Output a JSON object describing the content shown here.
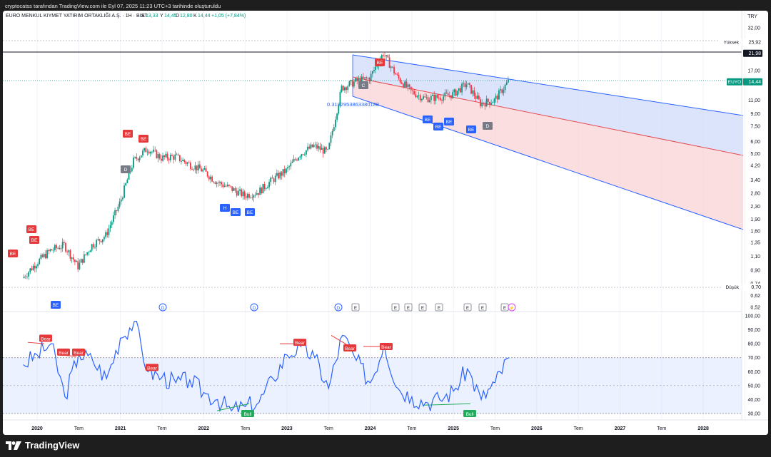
{
  "header": {
    "credit": "cryptocatss tarafından TradingView.com ile Eyl 07, 2025 11:23 UTC+3 tarihinde oluşturuldu",
    "currency": "TRY"
  },
  "legend": {
    "symbol": "EURO MENKUL KIYMET YATIRIM ORTAKLIĞI A.Ş. · 1H · BIST",
    "open_label": "A",
    "open": "13,33",
    "high_label": "Y",
    "high": "14,45",
    "low_label": "D",
    "low": "12,80",
    "close_label": "K",
    "close": "14,44",
    "change": "+1,05 (+7,84%)"
  },
  "price_axis": {
    "scale": "log",
    "ticks": [
      "32,00",
      "25,92",
      "21,98",
      "17,00",
      "14,44",
      "11,00",
      "9,00",
      "7,50",
      "6,00",
      "5,00",
      "4,20",
      "3,40",
      "2,80",
      "2,30",
      "1,90",
      "1,60",
      "1,35",
      "1,10",
      "0,90",
      "0,74",
      "0,70",
      "0,62",
      "0,52"
    ],
    "high_label": "Yüksek",
    "high_value": "25,92",
    "low_label": "Düşük",
    "low_value": "0,70",
    "line_value": "21,98",
    "ticker": "EUYO",
    "last_value": "14,44"
  },
  "rsi_axis": {
    "ticks": [
      "100,00",
      "90,00",
      "80,00",
      "70,00",
      "60,00",
      "50,00",
      "40,00",
      "30,00"
    ],
    "band": [
      30,
      70
    ]
  },
  "time_axis": {
    "ticks": [
      "2020",
      "Tem",
      "2021",
      "Tem",
      "2022",
      "Tem",
      "2023",
      "Tem",
      "2024",
      "Tem",
      "2025",
      "Tem",
      "2026",
      "Tem",
      "2027",
      "Tem",
      "2028"
    ]
  },
  "fib_label": "0.3182953863380188",
  "price_signals": [
    "BE",
    "BE",
    "BE",
    "BE",
    "BE",
    "BE",
    "D",
    "H",
    "BE",
    "BE",
    "C",
    "BE",
    "BE",
    "BE",
    "BE",
    "BE",
    "D"
  ],
  "event_markers": [
    "D",
    "D",
    "D",
    "E",
    "E",
    "E",
    "E",
    "E",
    "E",
    "E",
    "E",
    "⚡"
  ],
  "rsi_signals": [
    "Bear",
    "Bear",
    "Bear",
    "Bear",
    "Bear",
    "Bear",
    "Bear",
    "Bull",
    "Bull"
  ],
  "colors": {
    "up": "#089981",
    "down": "#f23645",
    "rsi": "#2962ff",
    "channel_upper": "#2962ff",
    "channel_mid": "#e5484d",
    "rsi_band": "#2962ff",
    "bull": "#22ab5a",
    "bear": "#e5383b"
  },
  "chart_data": [
    {
      "type": "candlestick",
      "title": "EURO MENKUL KIYMET YATIRIM ORTAKLIĞI A.Ş. · 1H · BIST",
      "ylabel": "TRY",
      "yscale": "log",
      "ylim": [
        0.5,
        32
      ],
      "x": [
        "2019-11",
        "2020-01",
        "2020-03",
        "2020-05",
        "2020-07",
        "2020-09",
        "2020-11",
        "2021-01",
        "2021-03",
        "2021-05",
        "2021-07",
        "2021-09",
        "2021-11",
        "2022-01",
        "2022-03",
        "2022-05",
        "2022-07",
        "2022-09",
        "2022-11",
        "2023-01",
        "2023-03",
        "2023-05",
        "2023-07",
        "2023-09",
        "2023-11",
        "2024-01",
        "2024-03",
        "2024-05",
        "2024-07",
        "2024-09",
        "2024-11",
        "2025-01",
        "2025-03",
        "2025-05",
        "2025-07",
        "2025-09"
      ],
      "close": [
        0.8,
        1.0,
        1.2,
        1.3,
        0.95,
        1.3,
        1.5,
        2.4,
        4.5,
        5.4,
        4.7,
        4.8,
        4.3,
        3.9,
        3.3,
        3.0,
        2.7,
        2.85,
        3.4,
        3.9,
        5.0,
        5.6,
        5.1,
        13.2,
        14.5,
        15.2,
        22.0,
        15.5,
        12.5,
        11.3,
        11.5,
        12.0,
        14.0,
        10.5,
        11.0,
        14.44
      ],
      "high_recorded": 25.92,
      "low_recorded": 0.7,
      "horizontal_line": 21.98
    },
    {
      "type": "line",
      "title": "RSI",
      "ylim": [
        25,
        100
      ],
      "x": [
        "2019-11",
        "2020-01",
        "2020-03",
        "2020-05",
        "2020-07",
        "2020-09",
        "2020-11",
        "2021-01",
        "2021-03",
        "2021-05",
        "2021-07",
        "2021-09",
        "2021-11",
        "2022-01",
        "2022-03",
        "2022-05",
        "2022-07",
        "2022-09",
        "2022-11",
        "2023-01",
        "2023-03",
        "2023-05",
        "2023-07",
        "2023-09",
        "2023-11",
        "2024-01",
        "2024-03",
        "2024-05",
        "2024-07",
        "2024-09",
        "2024-11",
        "2025-01",
        "2025-03",
        "2025-05",
        "2025-07",
        "2025-09"
      ],
      "series": [
        {
          "values": [
            65,
            72,
            80,
            42,
            73,
            68,
            55,
            84,
            96,
            60,
            56,
            52,
            54,
            45,
            40,
            32,
            35,
            38,
            55,
            72,
            78,
            70,
            48,
            86,
            68,
            52,
            80,
            48,
            42,
            38,
            40,
            46,
            62,
            40,
            52,
            70
          ]
        }
      ],
      "bands": [
        30,
        70
      ]
    }
  ]
}
